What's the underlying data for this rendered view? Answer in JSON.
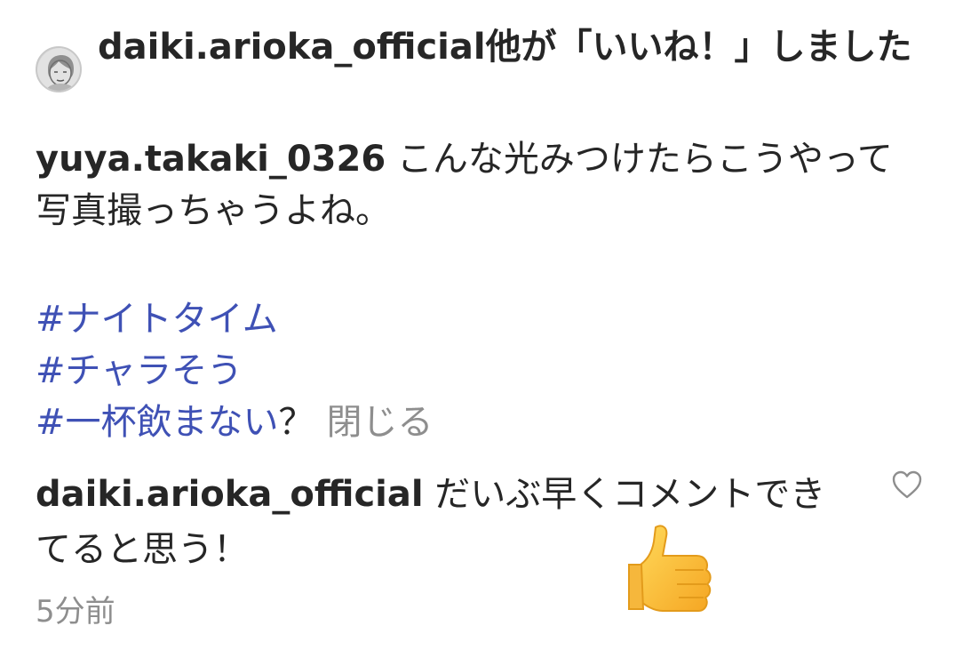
{
  "likes": {
    "text": "daiki.arioka_official他が「いいね！」しました"
  },
  "post": {
    "username": "yuya.takaki_0326",
    "caption": "こんな光みつけたらこうやって写真撮っちゃうよね。",
    "hashtags": [
      "#ナイトタイム",
      "#チャラそう",
      "#一杯飲まない"
    ],
    "question_mark": "？",
    "close_label": "閉じる"
  },
  "comment": {
    "username": "daiki.arioka_official",
    "text": "だいぶ早くコメントできてると思う！",
    "emoji": "thumbs-up",
    "like_icon": "heart-outline-icon"
  },
  "timestamp": "5分前",
  "colors": {
    "text": "#262626",
    "hashtag": "#3f51b5",
    "muted": "#8e8e8e"
  }
}
